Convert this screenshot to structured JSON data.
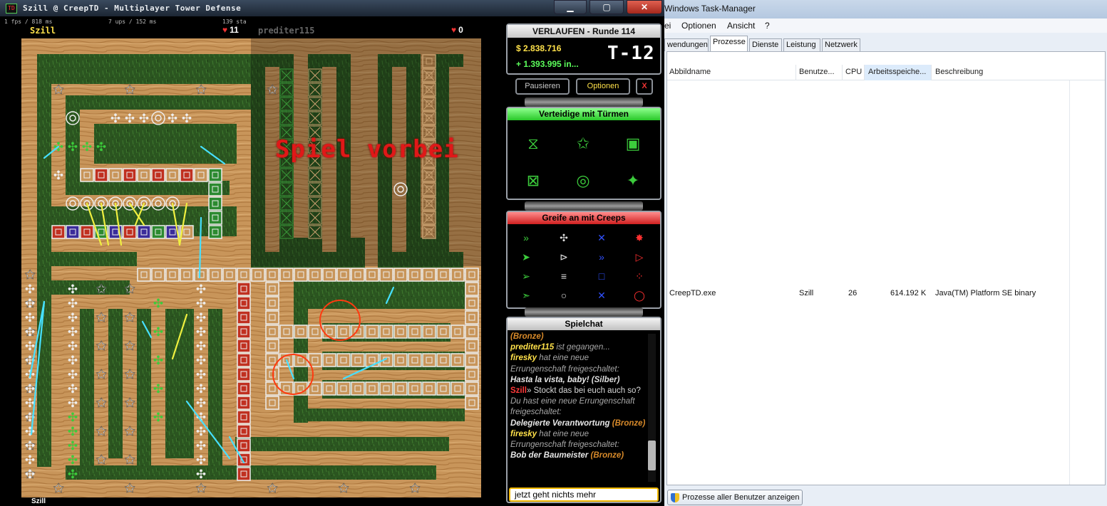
{
  "window": {
    "icon_text": "TD",
    "title": "Szill @ CreepTD - Multiplayer Tower Defense",
    "minimize": "▁",
    "maximize": "▢",
    "close": "✕"
  },
  "status": {
    "fps": "1 fps / 818 ms",
    "ups": "7 ups / 152 ms",
    "sta": "139 sta",
    "player_left": "Szill",
    "player_left_lives": "11",
    "player_right": "prediter115",
    "player_right_lives": "0",
    "bottom_name": "Szill"
  },
  "map": {
    "game_over": "Spiel vorbei",
    "colors": {
      "wood": "#c9955a",
      "grass": "#2d5a22",
      "tower_green": "#3ccc3c",
      "tower_red": "#c04020",
      "laser": "#46e0ff"
    }
  },
  "round": {
    "title": "VERLAUFEN - Runde 114",
    "money": "$ 2.838.716",
    "income": "+ 1.393.995 in...",
    "timer": "T-12"
  },
  "controls": {
    "pause": "Pausieren",
    "options": "Optionen",
    "quit": "X"
  },
  "defend": {
    "header": "Verteidige mit Türmen",
    "towers": [
      "hourglass-tower-icon",
      "star-tower-icon",
      "square-tower-icon",
      "cross-box-tower-icon",
      "ring-tower-icon",
      "spark-tower-icon"
    ]
  },
  "attack": {
    "header": "Greife an mit Creeps",
    "creeps": [
      "»",
      "✣",
      "✕",
      "✸",
      "➤",
      "⊳",
      "»",
      "▷",
      "➢",
      "≡",
      "□",
      "⁘",
      "➣",
      "○",
      "✕",
      "◯"
    ]
  },
  "chat": {
    "header": "Spielchat",
    "lines": [
      {
        "type": "bronze-tail",
        "text": "(Bronze)"
      },
      {
        "who": "prediter115",
        "rest": " ist gegangen..."
      },
      {
        "who": "firesky",
        "rest": " hat eine neue Errungenschaft freigeschaltet:",
        "ach": "Hasta la vista, baby!",
        "medal": "(Silber)"
      },
      {
        "who": "Szill",
        "rest": "» Stockt das bei euch auch so?"
      },
      {
        "text": "Du hast eine neue Errungenschaft freigeschaltet:",
        "ach": "Delegierte Verantwortung",
        "medal": "(Bronze)"
      },
      {
        "who": "firesky",
        "rest": " hat eine neue Errungenschaft freigeschaltet:",
        "ach": "Bob der Baumeister",
        "medal": "(Bronze)"
      }
    ],
    "input_value": "jetzt geht nichts mehr"
  },
  "taskmanager": {
    "title": "Windows Task-Manager",
    "menu": [
      "ei",
      "Optionen",
      "Ansicht",
      "?"
    ],
    "tabs": [
      "wendungen",
      "Prozesse",
      "Dienste",
      "Leistung",
      "Netzwerk"
    ],
    "columns": [
      "Abbildname",
      "Benutze...",
      "CPU",
      "Arbeitsspeiche...",
      "Beschreibung"
    ],
    "row": {
      "name": "CreepTD.exe",
      "user": "Szill",
      "cpu": "26",
      "memory": "614.192 K",
      "description": "Java(TM) Platform SE binary"
    },
    "show_all_button": "Prozesse aller Benutzer anzeigen"
  }
}
